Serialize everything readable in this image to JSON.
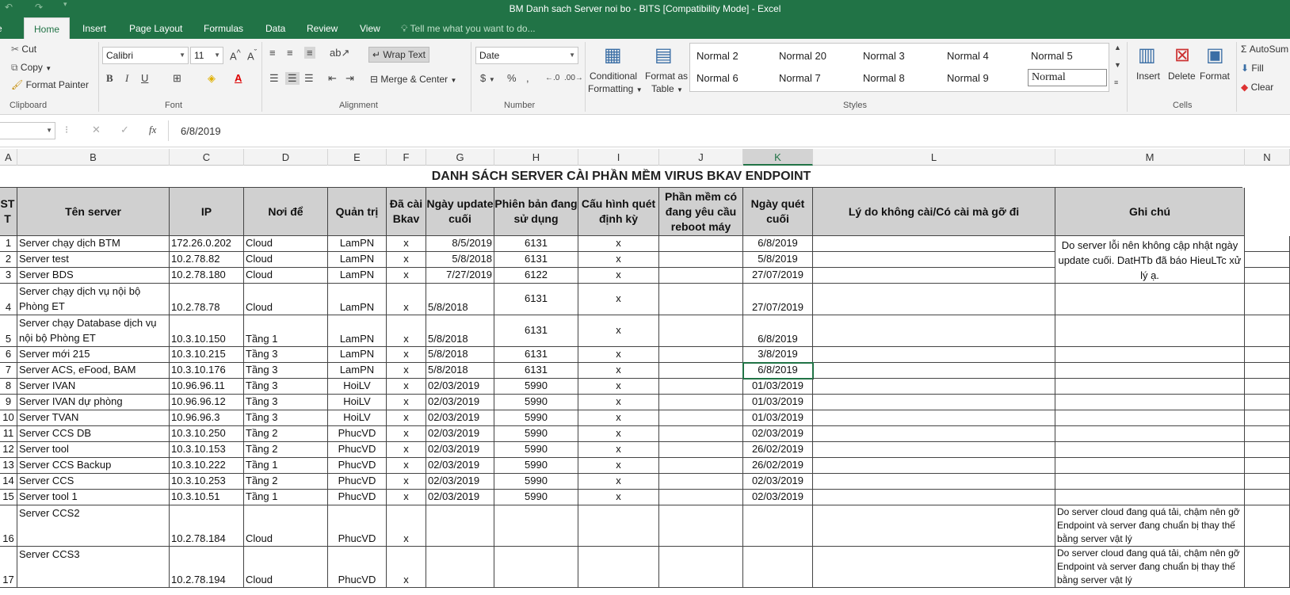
{
  "window": {
    "title": "BM Danh sach Server noi bo - BITS  [Compatibility Mode] - Excel"
  },
  "tabs": [
    {
      "label": "Home",
      "active": true
    },
    {
      "label": "Insert"
    },
    {
      "label": "Page Layout"
    },
    {
      "label": "Formulas"
    },
    {
      "label": "Data"
    },
    {
      "label": "Review"
    },
    {
      "label": "View"
    }
  ],
  "tell_me": "Tell me what you want to do...",
  "ribbon": {
    "clipboard": {
      "cut": "Cut",
      "copy": "Copy",
      "format_painter": "Format Painter",
      "label": "Clipboard"
    },
    "font": {
      "name": "Calibri",
      "size": "11",
      "label": "Font"
    },
    "alignment": {
      "wrap_text": "Wrap Text",
      "merge_center": "Merge & Center",
      "label": "Alignment"
    },
    "number": {
      "format": "Date",
      "label": "Number",
      "currency": "$",
      "percent": "%",
      "comma": ","
    },
    "styles": {
      "cond_format": "Conditional",
      "cond_format2": "Formatting",
      "format_table": "Format as",
      "format_table2": "Table",
      "label": "Styles",
      "gallery": [
        "Normal 2",
        "Normal 20",
        "Normal 3",
        "Normal 4",
        "Normal 5",
        "Normal 6",
        "Normal 7",
        "Normal 8",
        "Normal 9",
        "Normal"
      ]
    },
    "cells": {
      "insert": "Insert",
      "delete": "Delete",
      "format": "Format",
      "label": "Cells"
    },
    "editing": {
      "autosum": "AutoSum",
      "fill": "Fill",
      "clear": "Clear"
    }
  },
  "formula_bar": {
    "fx": "fx",
    "value": "6/8/2019"
  },
  "columns": [
    "A",
    "B",
    "C",
    "D",
    "E",
    "F",
    "G",
    "H",
    "I",
    "J",
    "K",
    "L",
    "M",
    "N"
  ],
  "sheet": {
    "title": "DANH SÁCH SERVER CÀI PHẦN MỀM VIRUS BKAV ENDPOINT",
    "headers": [
      "ST T",
      "Tên server",
      "IP",
      "Nơi để",
      "Quản trị",
      "Đã cài Bkav",
      "Ngày update cuối",
      "Phiên bản đang sử dụng",
      "Cấu hình quét định kỳ",
      "Phần mềm có đang yêu cầu reboot máy",
      "Ngày quét cuối",
      "Lý do không cài/Có cài mà gỡ đi",
      "Ghi chú"
    ],
    "rows": [
      [
        "1",
        "Server chạy dịch BTM",
        "172.26.0.202",
        "Cloud",
        "LamPN",
        "x",
        "8/5/2019",
        "6131",
        "x",
        "",
        "6/8/2019",
        "",
        ""
      ],
      [
        "2",
        "Server test",
        "10.2.78.82",
        "Cloud",
        "LamPN",
        "x",
        "5/8/2018",
        "6131",
        "x",
        "",
        "5/8/2019",
        "",
        ""
      ],
      [
        "3",
        "Server BDS",
        "10.2.78.180",
        "Cloud",
        "LamPN",
        "x",
        "7/27/2019",
        "6122",
        "x",
        "",
        "27/07/2019",
        "",
        ""
      ],
      [
        "4",
        "Server chạy dịch vụ nội bộ Phòng ET",
        "10.2.78.78",
        "Cloud",
        "LamPN",
        "x",
        "5/8/2018",
        "6131",
        "x",
        "",
        "27/07/2019",
        "",
        ""
      ],
      [
        "5",
        "Server chạy Database dịch vụ nội bộ Phòng ET",
        "10.3.10.150",
        "Tầng 1",
        "LamPN",
        "x",
        "5/8/2018",
        "6131",
        "x",
        "",
        "6/8/2019",
        "",
        ""
      ],
      [
        "6",
        "Server mới 215",
        "10.3.10.215",
        "Tầng 3",
        "LamPN",
        "x",
        "5/8/2018",
        "6131",
        "x",
        "",
        "3/8/2019",
        "",
        ""
      ],
      [
        "7",
        "Server ACS, eFood, BAM",
        "10.3.10.176",
        "Tầng 3",
        "LamPN",
        "x",
        "5/8/2018",
        "6131",
        "x",
        "",
        "6/8/2019",
        "",
        ""
      ],
      [
        "8",
        "Server IVAN",
        "10.96.96.11",
        "Tầng 3",
        "HoiLV",
        "x",
        "02/03/2019",
        "5990",
        "x",
        "",
        "01/03/2019",
        "",
        ""
      ],
      [
        "9",
        "Server IVAN dự phòng",
        "10.96.96.12",
        "Tầng 3",
        "HoiLV",
        "x",
        "02/03/2019",
        "5990",
        "x",
        "",
        "01/03/2019",
        "",
        ""
      ],
      [
        "10",
        "Server TVAN",
        "10.96.96.3",
        "Tầng 3",
        "HoiLV",
        "x",
        "02/03/2019",
        "5990",
        "x",
        "",
        "01/03/2019",
        "",
        ""
      ],
      [
        "11",
        "Server CCS DB",
        "10.3.10.250",
        "Tầng 2",
        "PhucVD",
        "x",
        "02/03/2019",
        "5990",
        "x",
        "",
        "02/03/2019",
        "",
        ""
      ],
      [
        "12",
        "Server tool",
        "10.3.10.153",
        "Tầng 2",
        "PhucVD",
        "x",
        "02/03/2019",
        "5990",
        "x",
        "",
        "26/02/2019",
        "",
        ""
      ],
      [
        "13",
        "Server CCS Backup",
        "10.3.10.222",
        "Tầng 1",
        "PhucVD",
        "x",
        "02/03/2019",
        "5990",
        "x",
        "",
        "26/02/2019",
        "",
        ""
      ],
      [
        "14",
        "Server CCS",
        "10.3.10.253",
        "Tầng 2",
        "PhucVD",
        "x",
        "02/03/2019",
        "5990",
        "x",
        "",
        "02/03/2019",
        "",
        ""
      ],
      [
        "15",
        "Server tool 1",
        "10.3.10.51",
        "Tầng 1",
        "PhucVD",
        "x",
        "02/03/2019",
        "5990",
        "x",
        "",
        "02/03/2019",
        "",
        ""
      ],
      [
        "16",
        "Server CCS2",
        "10.2.78.184",
        "Cloud",
        "PhucVD",
        "x",
        "",
        "",
        "",
        "",
        "",
        "",
        "Do server cloud đang quá tải, chậm nên gỡ Endpoint và server đang chuẩn bị thay thế bằng server vật lý"
      ],
      [
        "17",
        "Server CCS3",
        "10.2.78.194",
        "Cloud",
        "PhucVD",
        "x",
        "",
        "",
        "",
        "",
        "",
        "",
        "Do server cloud đang quá tải, chậm nên gỡ Endpoint và server đang chuẩn bị thay thế bằng server vật lý"
      ]
    ],
    "note_rows_1_3": "Do server lỗi nên không cập nhật ngày update cuối. DatHTb đã báo HieuLTc xử lý ạ."
  }
}
